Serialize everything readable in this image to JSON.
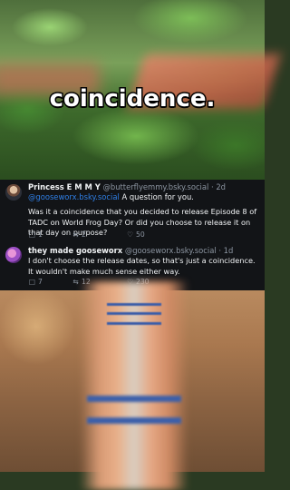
{
  "caption": "coincidence.",
  "posts": [
    {
      "name": "Princess E M M Y",
      "handle": "@butterflyemmy.bsky.social",
      "time": "· 2d",
      "mention": "@gooseworx.bsky.social",
      "lead": " A question for you.",
      "text": "Was it a coincidence that you decided to release Episode 8 of TADC on World Frog Day? Or did you choose to release it on that day on purpose?",
      "replies": "1",
      "reposts": "2",
      "likes": "50"
    },
    {
      "name": "they made gooseworx",
      "handle": "@gooseworx.bsky.social",
      "time": "· 1d",
      "text": "I don't choose the release dates, so that's just a coincidence. It wouldn't make much sense either way.",
      "replies": "7",
      "reposts": "12",
      "likes": "230"
    }
  ],
  "icons": {
    "reply": "reply-icon",
    "repost": "repost-icon",
    "like": "heart-icon"
  }
}
